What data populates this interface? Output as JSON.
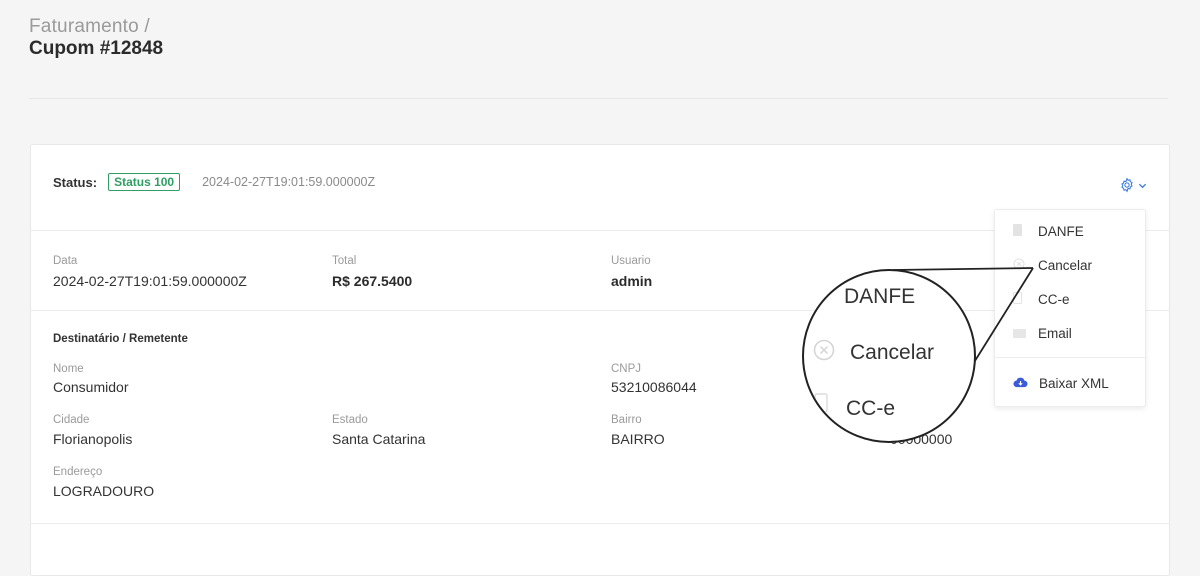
{
  "header": {
    "breadcrumb": "Faturamento /",
    "title": "Cupom #12848"
  },
  "status": {
    "label": "Status:",
    "badge": "Status 100",
    "timestamp": "2024-02-27T19:01:59.000000Z",
    "badge_color": "#2f9e63"
  },
  "actions": {
    "gear_icon": "gear-icon",
    "chevron_icon": "chevron-down-icon",
    "accent_color": "#3b7bd8"
  },
  "summary": {
    "data_label": "Data",
    "data_value": "2024-02-27T19:01:59.000000Z",
    "total_label": "Total",
    "total_value": "R$ 267.5400",
    "usuario_label": "Usuario",
    "usuario_value": "admin"
  },
  "recipient": {
    "section_title": "Destinatário / Remetente",
    "nome_label": "Nome",
    "nome_value": "Consumidor",
    "cnpj_label": "CNPJ",
    "cnpj_value": "53210086044",
    "cidade_label": "Cidade",
    "cidade_value": "Florianopolis",
    "estado_label": "Estado",
    "estado_value": "Santa Catarina",
    "bairro_label": "Bairro",
    "bairro_value": "BAIRRO",
    "cep_value": "00000000",
    "endereco_label": "Endereço",
    "endereco_value": "LOGRADOURO"
  },
  "dropdown": {
    "items": [
      {
        "label": "DANFE",
        "icon": "file-icon"
      },
      {
        "label": "Cancelar",
        "icon": "cancel-circle-icon"
      },
      {
        "label": "CC-e",
        "icon": "document-icon"
      },
      {
        "label": "Email",
        "icon": "email-icon"
      }
    ],
    "download": {
      "label": "Baixar XML",
      "icon": "cloud-download-icon",
      "color": "#3b5bdb"
    }
  },
  "magnifier": {
    "items": [
      "DANFE",
      "Cancelar",
      "CC-e"
    ]
  }
}
